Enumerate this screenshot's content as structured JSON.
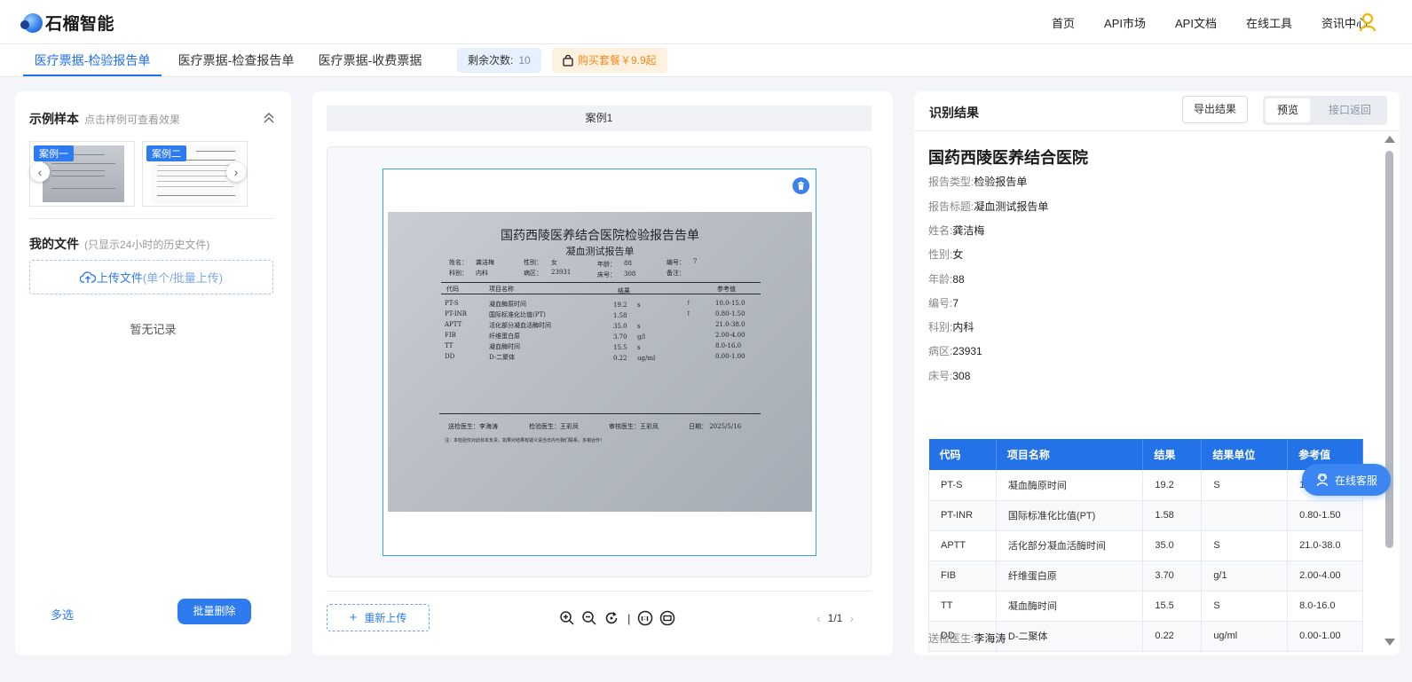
{
  "header": {
    "logo_text": "石榴智能",
    "nav": [
      "首页",
      "API市场",
      "API文档",
      "在线工具",
      "资讯中心"
    ]
  },
  "tabs": [
    "医疗票据-检验报告单",
    "医疗票据-检查报告单",
    "医疗票据-收费票据"
  ],
  "remaining": {
    "label": "剩余次数:",
    "count": "10"
  },
  "buy_label": "购买套餐￥9.9起",
  "left": {
    "samples_title": "示例样本",
    "samples_hint": "点击样例可查看效果",
    "thumbs": [
      "案例一",
      "案例二"
    ],
    "myfiles_title": "我的文件",
    "myfiles_hint": "(只显示24小时的历史文件)",
    "upload_label": "上传文件",
    "upload_hint": "(单个/批量上传)",
    "empty_text": "暂无记录",
    "multi_label": "多选",
    "batch_delete_label": "批量删除"
  },
  "middle": {
    "case_label": "案例1",
    "reupload_label": "重新上传",
    "separator": "|",
    "page": "1/1",
    "document": {
      "title": "国药西陵医养结合医院检验报告告单",
      "subtitle": "凝血测试报告单",
      "info1": [
        "姓名：",
        "龚洁梅",
        "性别：",
        "女",
        "年龄：",
        "88",
        "编号：",
        "7"
      ],
      "info2": [
        "科别：",
        "内科",
        "病区：",
        "23931",
        "床号：",
        "308",
        "备注："
      ],
      "cols": [
        "代码",
        "项目名称",
        "结果",
        "参考值"
      ],
      "rows": [
        [
          "PT-S",
          "凝血酶原时间",
          "19.2",
          "s",
          "↑",
          "10.0-15.0"
        ],
        [
          "PT-INR",
          "国际标准化比值(PT)",
          "1.58",
          "",
          "↑",
          "0.80-1.50"
        ],
        [
          "APTT",
          "活化部分凝血活酶时间",
          "35.0",
          "s",
          "",
          "21.0-38.0"
        ],
        [
          "FIB",
          "纤维蛋白原",
          "3.70",
          "g/l",
          "",
          "2.00-4.00"
        ],
        [
          "TT",
          "凝血酶时间",
          "15.5",
          "s",
          "",
          "8.0-16.0"
        ],
        [
          "DD",
          "D-二聚体",
          "0.22",
          "ug/ml",
          "",
          "0.00-1.00"
        ]
      ],
      "footer": [
        "送检医生：李海涛",
        "检验医生：王彩凤",
        "审核医生：王彩凤",
        "日期：  2025/5/16"
      ],
      "note": "注：本检验仅对此标本负责，如果对结果有疑义请当日内与我们联系，多谢合作！"
    }
  },
  "right": {
    "title": "识别结果",
    "export_label": "导出结果",
    "view_preview": "预览",
    "view_api": "接口返回",
    "hospital": "国药西陵医养结合医院",
    "fields": [
      {
        "k": "报告类型:",
        "v": "检验报告单"
      },
      {
        "k": "报告标题:",
        "v": "凝血测试报告单"
      },
      {
        "k": "姓名:",
        "v": "龚洁梅"
      },
      {
        "k": "性别:",
        "v": "女"
      },
      {
        "k": "年龄:",
        "v": "88"
      },
      {
        "k": "编号:",
        "v": "7"
      },
      {
        "k": "科别:",
        "v": "内科"
      },
      {
        "k": "病区:",
        "v": "23931"
      },
      {
        "k": "床号:",
        "v": "308"
      }
    ],
    "table": {
      "headers": [
        "代码",
        "项目名称",
        "结果",
        "结果单位",
        "参考值"
      ],
      "rows": [
        [
          "PT-S",
          "凝血酶原时间",
          "19.2",
          "S",
          "10.0-15.0"
        ],
        [
          "PT-INR",
          "国际标准化比值(PT)",
          "1.58",
          "",
          "0.80-1.50"
        ],
        [
          "APTT",
          "活化部分凝血活酶时间",
          "35.0",
          "S",
          "21.0-38.0"
        ],
        [
          "FIB",
          "纤维蛋白原",
          "3.70",
          "g/1",
          "2.00-4.00"
        ],
        [
          "TT",
          "凝血酶时间",
          "15.5",
          "S",
          "8.0-16.0"
        ],
        [
          "DD",
          "D-二聚体",
          "0.22",
          "ug/ml",
          "0.00-1.00"
        ]
      ]
    },
    "footer_field": {
      "k": "送检医生:",
      "v": "李海涛"
    }
  },
  "chat_label": "在线客服",
  "colors": {
    "primary": "#2e7bf0",
    "table_header": "#2372e8",
    "buy": "#f08a1c"
  }
}
